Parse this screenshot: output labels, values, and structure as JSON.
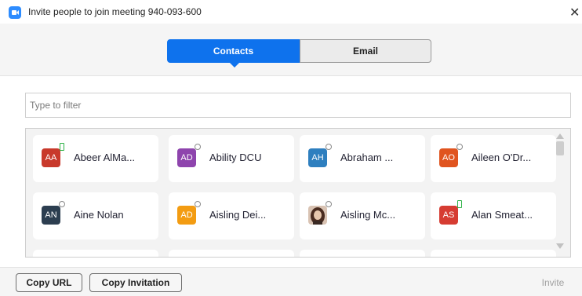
{
  "window": {
    "title": "Invite people to join meeting 940-093-600",
    "close_glyph": "✕"
  },
  "tabs": [
    {
      "label": "Contacts",
      "selected": true
    },
    {
      "label": "Email",
      "selected": false
    }
  ],
  "filter": {
    "placeholder": "Type to filter",
    "value": ""
  },
  "contacts": [
    {
      "initials": "AA",
      "name": "Abeer AlMa...",
      "color": "#c8392b",
      "status": "mobile"
    },
    {
      "initials": "AD",
      "name": "Ability DCU",
      "color": "#8e44ad",
      "status": "offline"
    },
    {
      "initials": "AH",
      "name": "Abraham ...",
      "color": "#2e7fbf",
      "status": "offline"
    },
    {
      "initials": "AO",
      "name": "Aileen O'Dr...",
      "color": "#e0541f",
      "status": "offline"
    },
    {
      "initials": "AN",
      "name": "Aine Nolan",
      "color": "#2c3e50",
      "status": "offline"
    },
    {
      "initials": "AD",
      "name": "Aisling Dei...",
      "color": "#f39c12",
      "status": "offline"
    },
    {
      "initials": "",
      "name": "Aisling Mc...",
      "color": "#6b4a3a",
      "status": "offline"
    },
    {
      "initials": "AS",
      "name": "Alan Smeat...",
      "color": "#d63c32",
      "status": "mobile"
    }
  ],
  "footer": {
    "copy_url": "Copy URL",
    "copy_invitation": "Copy Invitation",
    "invite": "Invite"
  },
  "colors": {
    "accent": "#0e72ed",
    "status_offline": "#8a8a8a",
    "status_mobile": "#2bb144"
  }
}
